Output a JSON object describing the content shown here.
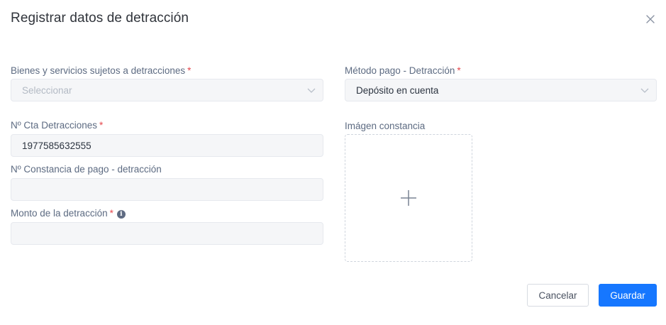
{
  "dialog": {
    "title": "Registrar datos de detracción",
    "close_icon": "close-icon"
  },
  "form": {
    "bienes": {
      "label": "Bienes y servicios sujetos a detracciones",
      "required_mark": "*",
      "placeholder": "Seleccionar",
      "value": ""
    },
    "metodo_pago": {
      "label": "Método pago - Detracción",
      "required_mark": "*",
      "value": "Depósito en cuenta"
    },
    "cta_detracciones": {
      "label": "Nº Cta Detracciones",
      "required_mark": "*",
      "value": "1977585632555"
    },
    "constancia_pago": {
      "label": "Nº Constancia de pago - detracción",
      "value": ""
    },
    "monto": {
      "label": "Monto de la detracción",
      "required_mark": "*",
      "info_icon": "info-icon",
      "value": ""
    },
    "imagen_constancia": {
      "label": "Imágen constancia",
      "upload_icon": "plus-icon"
    }
  },
  "footer": {
    "cancel_label": "Cancelar",
    "save_label": "Guardar"
  },
  "colors": {
    "primary": "#1677ff",
    "required": "#e5484d",
    "field_bg": "#f5f6f8"
  }
}
